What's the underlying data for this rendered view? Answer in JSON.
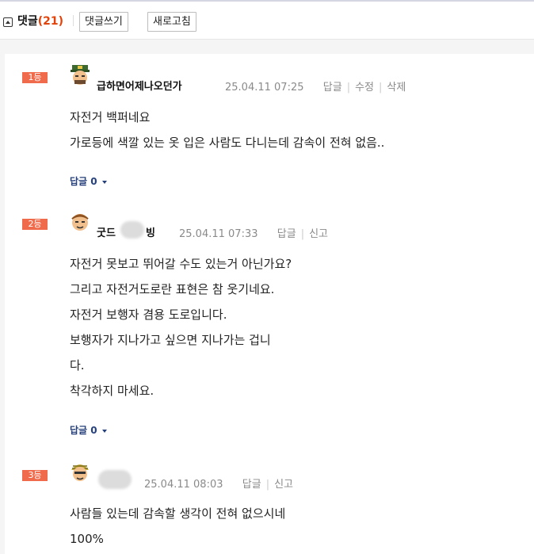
{
  "header": {
    "title": "댓글",
    "count": "(21)",
    "write_button": "댓글쓰기",
    "refresh_button": "새로고침"
  },
  "comments": [
    {
      "rank": "1등",
      "nickname": "급하면어제나오던가",
      "time": "25.04.11 07:25",
      "actions": [
        "답글",
        "수정",
        "삭제"
      ],
      "lines": [
        "자전거 백퍼네요",
        "가로등에 색깔 있는 옷 입은 사람도 다니는데 감속이 전혀 없음.."
      ],
      "reply_label": "답글 0"
    },
    {
      "rank": "2등",
      "nickname": "굿드",
      "nickname_tail": "빙",
      "time": "25.04.11 07:33",
      "actions": [
        "답글",
        "신고"
      ],
      "lines": [
        "자전거 못보고 뛰어갈 수도 있는거 아닌가요?",
        "그리고 자전거도로란 표현은 참 웃기네요.",
        "자전거 보행자 겸용 도로입니다.",
        "보행자가 지나가고 싶으면 지나가는 겁니",
        "다.",
        "착각하지 마세요."
      ],
      "reply_label": "답글 0"
    },
    {
      "rank": "3등",
      "nickname": "",
      "time": "25.04.11 08:03",
      "actions": [
        "답글",
        "신고"
      ],
      "lines": [
        "사람들 있는데 감속할 생각이 전혀 없으시네",
        "100%"
      ]
    }
  ],
  "colors": {
    "accent": "#e2430a",
    "rank_badge": "#f06b4b",
    "reply_link": "#243f7a"
  },
  "icons": {
    "toggle": "collapse-toggle-icon",
    "reply_caret": "caret-down-icon",
    "avatar": "user-avatar-icon"
  }
}
